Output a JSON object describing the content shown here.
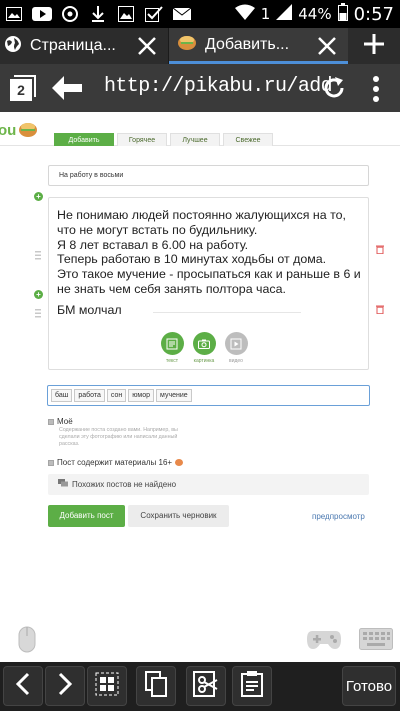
{
  "status_bar": {
    "sim": "1",
    "battery": "44%",
    "time": "0:57"
  },
  "tabs": [
    {
      "title": "Страница..."
    },
    {
      "title": "Добавить..."
    }
  ],
  "address_bar": {
    "tab_count": "2",
    "url": "http://pikabu.ru/add"
  },
  "nav": {
    "tabs": [
      "Добавить пост",
      "Горячее",
      "Лучшее",
      "Свежее"
    ]
  },
  "form": {
    "title_value": "На работу в восьми",
    "editor_lines": [
      "Не понимаю людей постоянно жалующихся на то, что не могут встать по будильнику.",
      "Я 8 лет вставал в 6.00 на работу.",
      "Теперь работаю в 10 минутах ходьбы от дома.",
      "Это такое мучение - просыпаться как и раньше в 6 и не знать чем себя занять полтора часа."
    ],
    "signature": "БМ молчал",
    "block_buttons": [
      "текст",
      "картинка",
      "видео"
    ],
    "tags": [
      "баш",
      "работа",
      "сон",
      "юмор",
      "мучение"
    ],
    "mine_label": "Моё",
    "mine_hint": "Содержание поста создано вами. Например, вы сделали эту фотографию или написали данный рассказ.",
    "adult_label": "Пост содержит материалы 16+",
    "similar_text": "Похожих постов не найдено",
    "add_button": "Добавить пост",
    "draft_button": "Сохранить черновик",
    "preview_link": "предпросмотр"
  },
  "bottom_bar": {
    "done_label": "Готово"
  },
  "colors": {
    "accent_green": "#5cae46",
    "link_blue": "#4a78b0"
  }
}
